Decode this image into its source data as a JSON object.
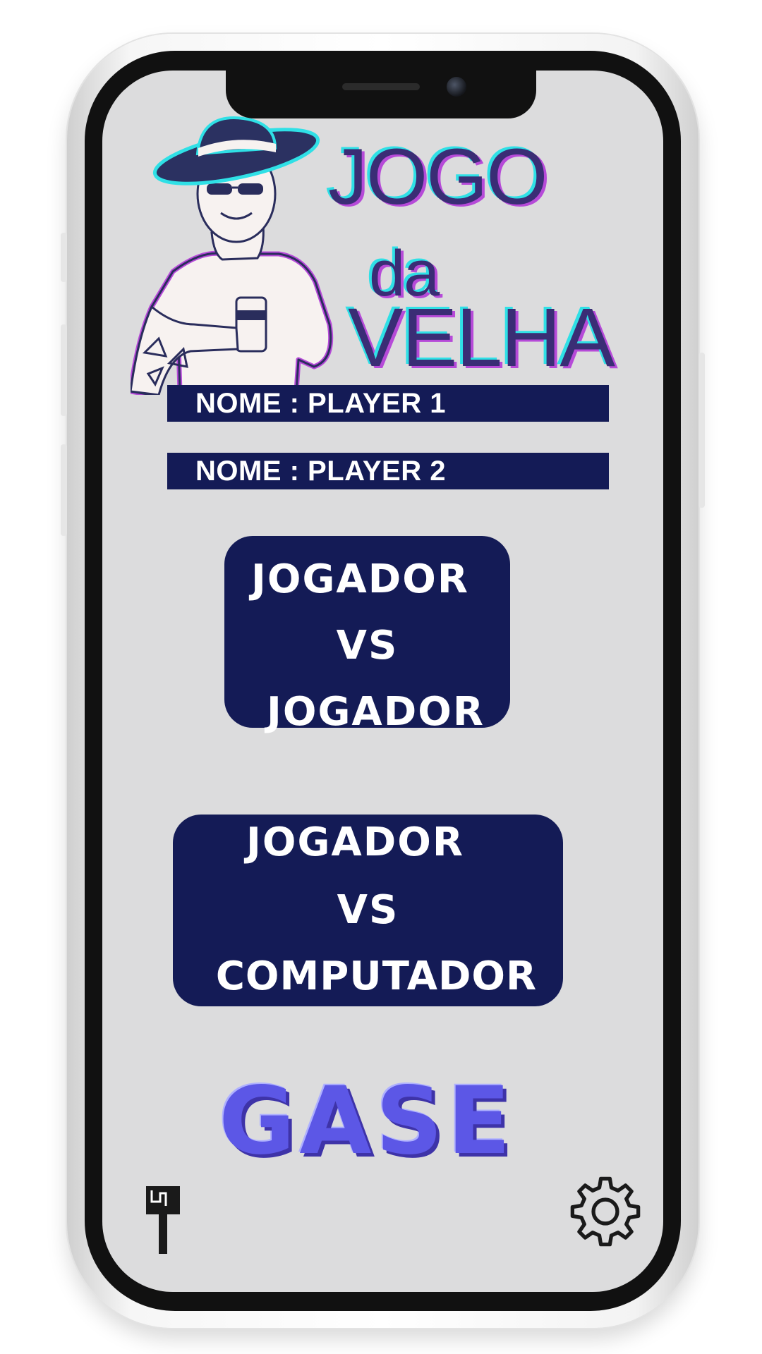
{
  "logo": {
    "line1": "JOGO",
    "line2": "da",
    "line3": "VELHA"
  },
  "players": [
    {
      "label": "NOME : PLAYER 1"
    },
    {
      "label": "NOME : PLAYER 2"
    }
  ],
  "modes": {
    "pvp": {
      "line1": "JOGADOR",
      "line2": "VS",
      "line3": "JOGADOR"
    },
    "pvc": {
      "line1": "JOGADOR",
      "line2": "VS",
      "line3": "COMPUTADOR"
    }
  },
  "brand": {
    "name": "GASE"
  },
  "icons": {
    "theme": "paint-brush-icon",
    "settings": "gear-icon"
  },
  "colors": {
    "screen_bg": "#dcdcdd",
    "button_bg": "#141b56",
    "logo_text": "#3a2d75",
    "logo_cyan": "#2fe0e6",
    "logo_magenta": "#b64ad8",
    "brand": "#5c57e6"
  }
}
